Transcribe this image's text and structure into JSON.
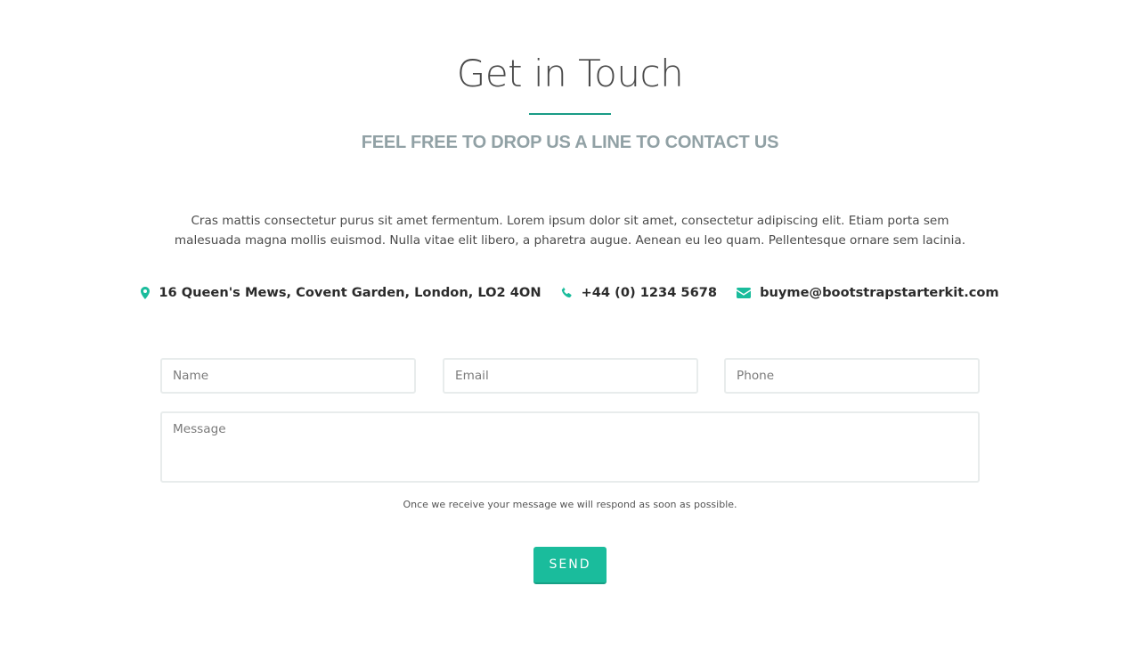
{
  "header": {
    "title": "Get in Touch",
    "subtitle": "FEEL FREE TO DROP US A LINE TO CONTACT US"
  },
  "intro": {
    "text": "Cras mattis consectetur purus sit amet fermentum. Lorem ipsum dolor sit amet, consectetur adipiscing elit. Etiam porta sem malesuada magna mollis euismod. Nulla vitae elit libero, a pharetra augue. Aenean eu leo quam. Pellentesque ornare sem lacinia."
  },
  "contact": {
    "address": "16 Queen's Mews, Covent Garden, London, LO2 4ON",
    "phone": "+44 (0) 1234 5678",
    "email": "buyme@bootstrapstarterkit.com",
    "icons": [
      "map-marker-icon",
      "phone-icon",
      "envelope-icon"
    ]
  },
  "form": {
    "name_placeholder": "Name",
    "email_placeholder": "Email",
    "phone_placeholder": "Phone",
    "message_placeholder": "Message",
    "note": "Once we receive your message we will respond as soon as possible.",
    "send_label": "SEND"
  },
  "colors": {
    "accent": "#1abc9c",
    "accent_dark": "#1a9c86",
    "subtitle": "#91a1a5"
  }
}
